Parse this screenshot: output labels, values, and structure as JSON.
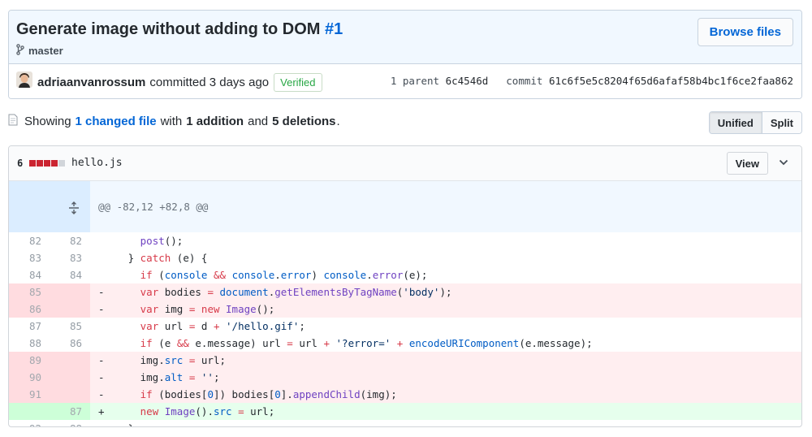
{
  "commit": {
    "title": "Generate image without adding to DOM",
    "number": "#1",
    "branch": "master",
    "browse_label": "Browse files",
    "author": "adriaanvanrossum",
    "action": "committed 3 days ago",
    "verified": "Verified",
    "parent_label": "1 parent",
    "parent_sha": "6c4546d",
    "commit_label": "commit",
    "commit_sha": "61c6f5e5c8204f65d6afaf58b4bc1f6ce2faa862"
  },
  "summary": {
    "showing": "Showing",
    "changed_files": "1 changed file",
    "with": "with",
    "additions": "1 addition",
    "and": "and",
    "deletions": "5 deletions",
    "period": "."
  },
  "view_toggle": {
    "unified": "Unified",
    "split": "Split",
    "selected": "Unified"
  },
  "file": {
    "change_count": "6",
    "name": "hello.js",
    "view_label": "View",
    "hunk_header": "@@ -82,12 +82,8 @@"
  },
  "colors": {
    "deletion": "#cb2431",
    "neutral": "#d1d5da",
    "link": "#0366d6",
    "verified": "#28a745"
  }
}
